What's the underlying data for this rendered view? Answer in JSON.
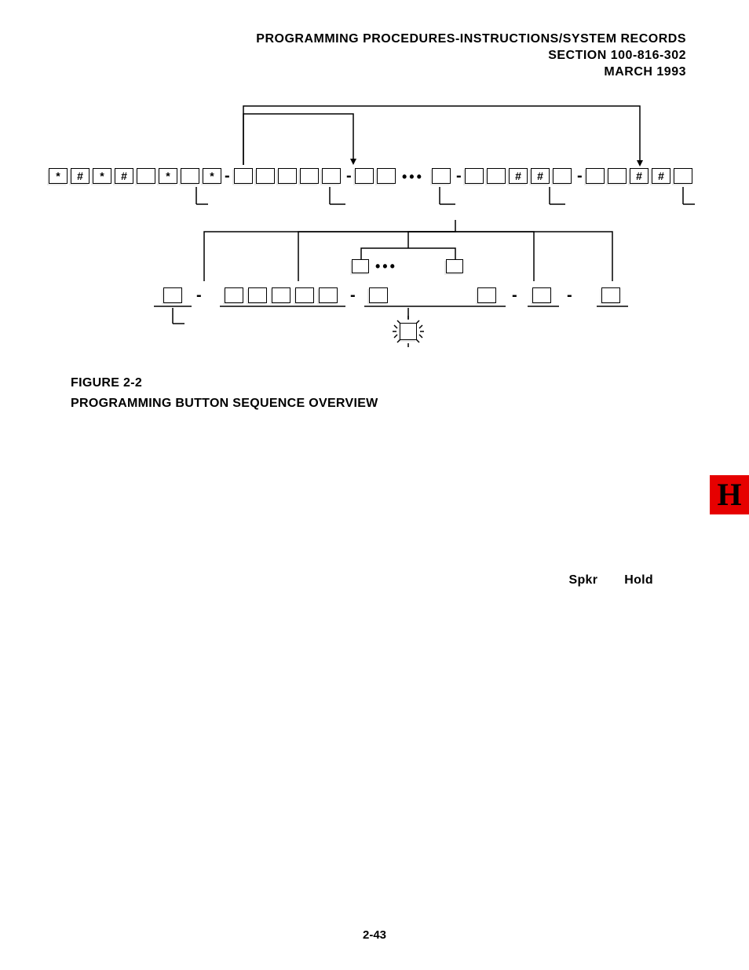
{
  "header": {
    "line1": "PROGRAMMING PROCEDURES-INSTRUCTIONS/SYSTEM RECORDS",
    "line2": "SECTION 100-816-302",
    "line3": "MARCH 1993"
  },
  "caption": {
    "line1": "FIGURE 2-2",
    "line2": "PROGRAMMING BUTTON SEQUENCE OVERVIEW"
  },
  "tab": "H",
  "footer": {
    "left": "Spkr",
    "right": "Hold"
  },
  "pagenum": "2-43",
  "symbols": {
    "star": "*",
    "hash": "#",
    "dash": "-"
  }
}
